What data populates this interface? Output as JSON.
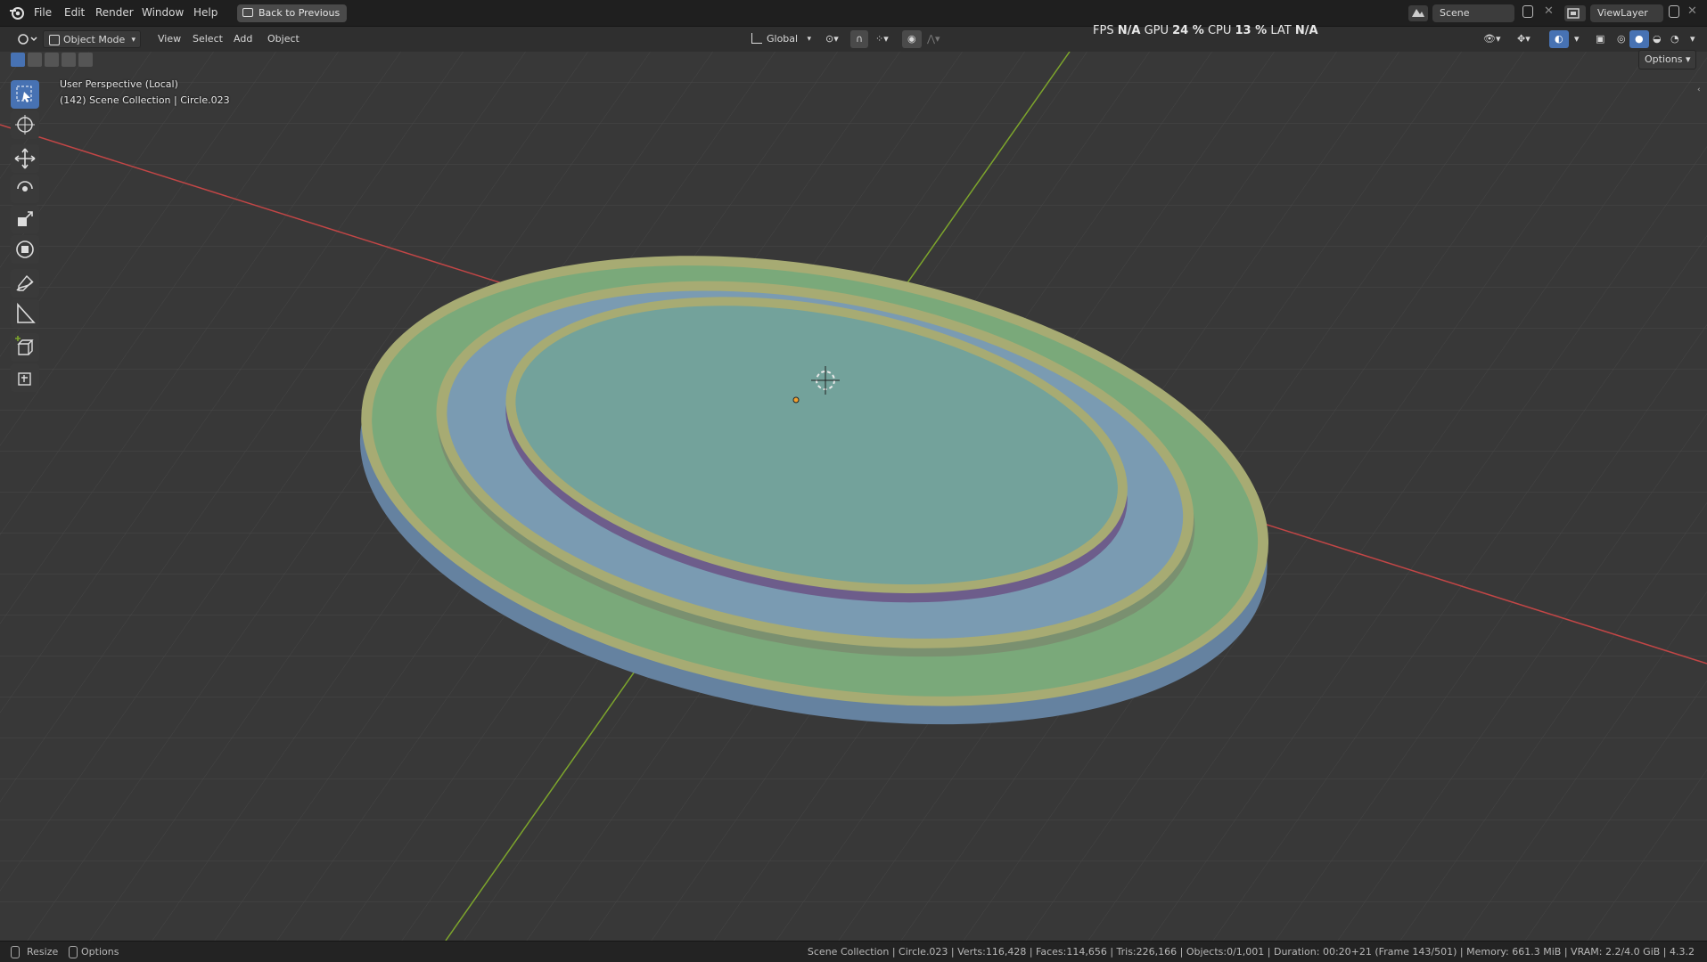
{
  "menu": {
    "items": [
      "File",
      "Edit",
      "Render",
      "Window",
      "Help"
    ],
    "back_button": "Back to Previous"
  },
  "scene_field": {
    "value": "Scene"
  },
  "viewlayer_field": {
    "value": "ViewLayer"
  },
  "header": {
    "mode": "Object Mode",
    "menus": [
      "View",
      "Select",
      "Add",
      "Object"
    ],
    "orientation": "Global",
    "options": "Options"
  },
  "perf": {
    "fps_label": "FPS",
    "fps_value": "N/A",
    "gpu_label": "GPU",
    "gpu_value": "24 %",
    "cpu_label": "CPU",
    "cpu_value": "13 %",
    "lat_label": "LAT",
    "lat_value": "N/A"
  },
  "viewport": {
    "view_name": "User Perspective (Local)",
    "collection_info": "(142) Scene Collection | Circle.023",
    "colors": {
      "background": "#3a3a3a",
      "grid": "#4a4a4a",
      "x_axis": "#c24646",
      "y_axis": "#7da52c",
      "ring_outer": "#7aa97a",
      "ring_rim": "#a7ab73",
      "ring_middle": "#7a9bb2",
      "disc_top": "#73a29b"
    }
  },
  "tools": [
    "select-box-icon",
    "cursor-icon",
    "move-icon",
    "rotate-icon",
    "scale-icon",
    "transform-icon",
    "annotate-icon",
    "measure-icon",
    "add-cube-icon",
    "add-object-icon"
  ],
  "status": {
    "left_items": [
      "Resize",
      "Options"
    ],
    "right_text": "Scene Collection | Circle.023 | Verts:116,428 | Faces:114,656 | Tris:226,166 | Objects:0/1,001 | Duration: 00:20+21 (Frame 143/501) | Memory: 661.3 MiB | VRAM: 2.2/4.0 GiB | 4.3.2"
  }
}
